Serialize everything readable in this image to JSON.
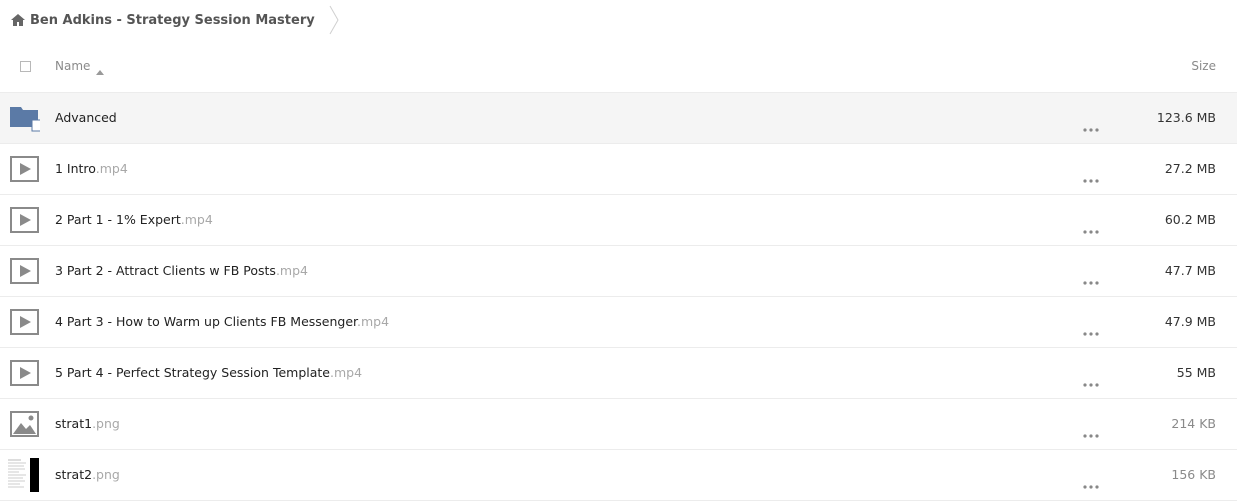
{
  "breadcrumb": {
    "label": "Ben Adkins - Strategy Session Mastery"
  },
  "header": {
    "name_label": "Name",
    "size_label": "Size"
  },
  "files": [
    {
      "name": "Advanced",
      "ext": "",
      "size": "123.6 MB",
      "icon": "folder-icon"
    },
    {
      "name": "1 Intro",
      "ext": ".mp4",
      "size": "27.2 MB",
      "icon": "video-icon"
    },
    {
      "name": "2 Part 1 - 1% Expert",
      "ext": ".mp4",
      "size": "60.2 MB",
      "icon": "video-icon"
    },
    {
      "name": "3 Part 2 - Attract Clients w FB Posts",
      "ext": ".mp4",
      "size": "47.7 MB",
      "icon": "video-icon"
    },
    {
      "name": "4 Part 3 - How to Warm up Clients FB Messenger",
      "ext": ".mp4",
      "size": "47.9 MB",
      "icon": "video-icon"
    },
    {
      "name": "5 Part 4 - Perfect Strategy Session Template",
      "ext": ".mp4",
      "size": "55 MB",
      "icon": "video-icon"
    },
    {
      "name": "strat1",
      "ext": ".png",
      "size": "214 KB",
      "icon": "image-icon"
    },
    {
      "name": "strat2",
      "ext": ".png",
      "size": "156 KB",
      "icon": "image-thumbnail"
    }
  ],
  "colors": {
    "folder": "#5b7aa6",
    "icon_gray": "#8a8a8a",
    "row_highlight": "#f5f5f5"
  }
}
